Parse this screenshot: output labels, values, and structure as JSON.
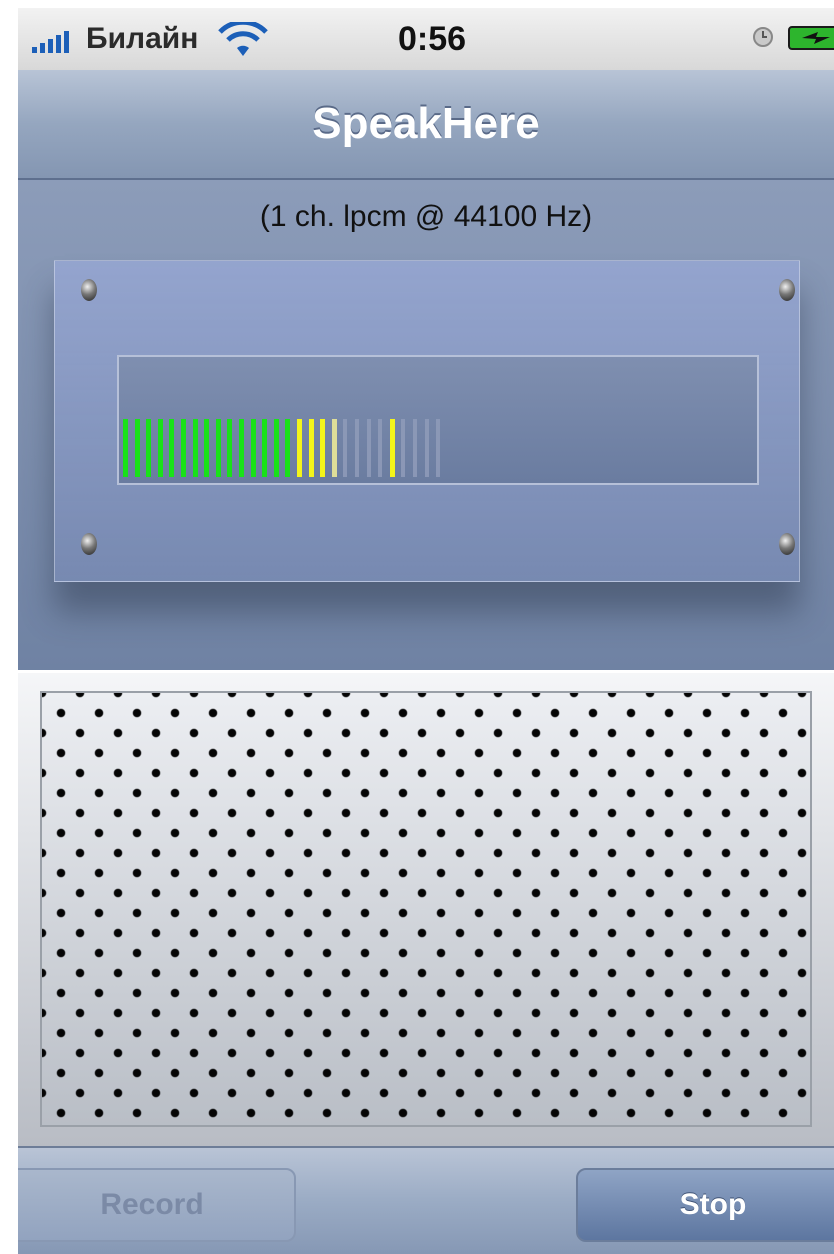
{
  "status_bar": {
    "carrier": "Билайн",
    "time": "0:56"
  },
  "nav": {
    "title": "SpeakHere"
  },
  "info": {
    "format": "(1 ch. lpcm @ 44100 Hz)"
  },
  "level_meter": {
    "segments": [
      "green",
      "green",
      "green",
      "green",
      "green",
      "green",
      "green",
      "green",
      "green",
      "green",
      "green",
      "green",
      "green",
      "green",
      "green",
      "yellow",
      "yellow",
      "yellow",
      "pale-yellow",
      "gray",
      "gray",
      "gray",
      "gray",
      "yellow",
      "gray",
      "gray",
      "gray",
      "gray"
    ],
    "colors": {
      "green": "#19e219",
      "yellow": "#f4f51a",
      "pale-yellow": "#dede99",
      "gray": "#8e9ab8"
    }
  },
  "toolbar": {
    "record_label": "Record",
    "stop_label": "Stop"
  }
}
